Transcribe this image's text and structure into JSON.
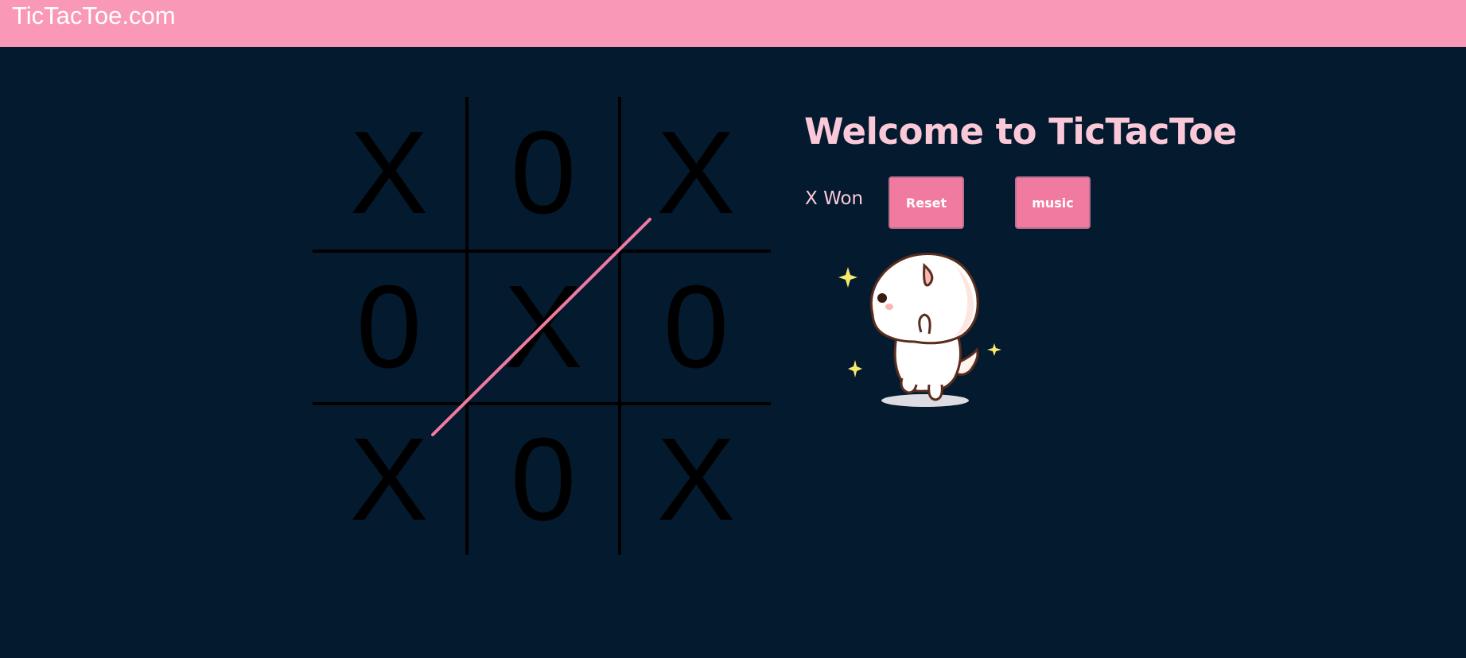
{
  "navbar": {
    "brand": "TicTacToe.com"
  },
  "board": {
    "cells": [
      "X",
      "0",
      "X",
      "0",
      "X",
      "0",
      "X",
      "0",
      "X"
    ],
    "winning_line_color": "#f17aa0"
  },
  "info": {
    "title": "Welcome to TicTacToe",
    "status": "X Won",
    "reset_label": "Reset",
    "music_label": "music"
  },
  "colors": {
    "navbar": "#f998b7",
    "background": "#041a2f",
    "accent": "#f17aa0",
    "title_text": "#fbc8d8"
  },
  "mascot": {
    "icon": "cute-cat-icon"
  }
}
